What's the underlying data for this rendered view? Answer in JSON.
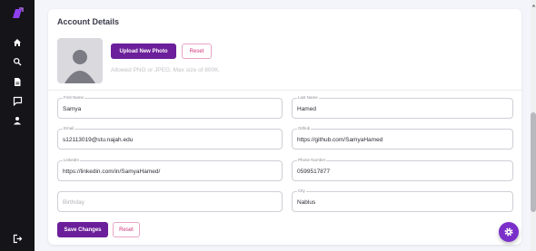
{
  "sidebar": {
    "icons": [
      "logo-icon",
      "home-icon",
      "search-icon",
      "document-icon",
      "chat-icon",
      "user-icon",
      "logout-icon"
    ],
    "accent": "#7a2fc9"
  },
  "card": {
    "title": "Account Details",
    "upload_label": "Upload New Photo",
    "reset_label": "Reset",
    "hint": "Allowed PNG or JPEG. Max size of 800K."
  },
  "form": {
    "first_name": {
      "label": "First Name",
      "value": "Samya"
    },
    "last_name": {
      "label": "Last Name",
      "value": "Hamed"
    },
    "email": {
      "label": "Email",
      "value": "s12113019@stu.najah.edu"
    },
    "github": {
      "label": "Github",
      "value": "https://github.com/SamyaHamed"
    },
    "linkedin": {
      "label": "LinkedIn",
      "value": "https://linkedin.com/in/SamyaHamed/"
    },
    "phone": {
      "label": "Phone Number",
      "value": "0599517877"
    },
    "birthday": {
      "placeholder": "Birthday"
    },
    "city": {
      "label": "City",
      "value": "Nablus"
    }
  },
  "actions": {
    "save_label": "Save Changes",
    "reset_label": "Reset"
  },
  "colors": {
    "primary": "#6b1f9a",
    "reset_text": "#d1307a",
    "sidebar_bg": "#141419"
  }
}
